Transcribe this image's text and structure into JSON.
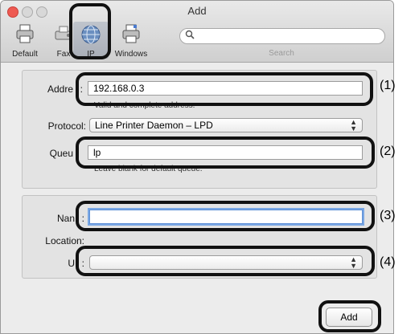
{
  "window": {
    "title": "Add"
  },
  "toolbar": {
    "items": [
      {
        "label": "Default",
        "icon": "printer-icon"
      },
      {
        "label": "Fax",
        "icon": "fax-icon"
      },
      {
        "label": "IP",
        "icon": "globe-icon"
      },
      {
        "label": "Windows",
        "icon": "windows-printer-icon"
      }
    ],
    "search_label": "Search"
  },
  "form": {
    "address_label": "Addre",
    "address_value": "192.168.0.3",
    "address_hint": "Valid and complete address.",
    "protocol_label": "Protocol:",
    "protocol_value": "Line Printer Daemon – LPD",
    "queue_label": "Queu",
    "queue_value": "lp",
    "queue_hint": "Leave blank for default queue.",
    "name_label": "Nan",
    "name_value": "",
    "location_label": "Location:",
    "use_label": "U",
    "use_value": ""
  },
  "add_button": "Add",
  "callouts": [
    "(1)",
    "(2)",
    "(3)",
    "(4)"
  ]
}
